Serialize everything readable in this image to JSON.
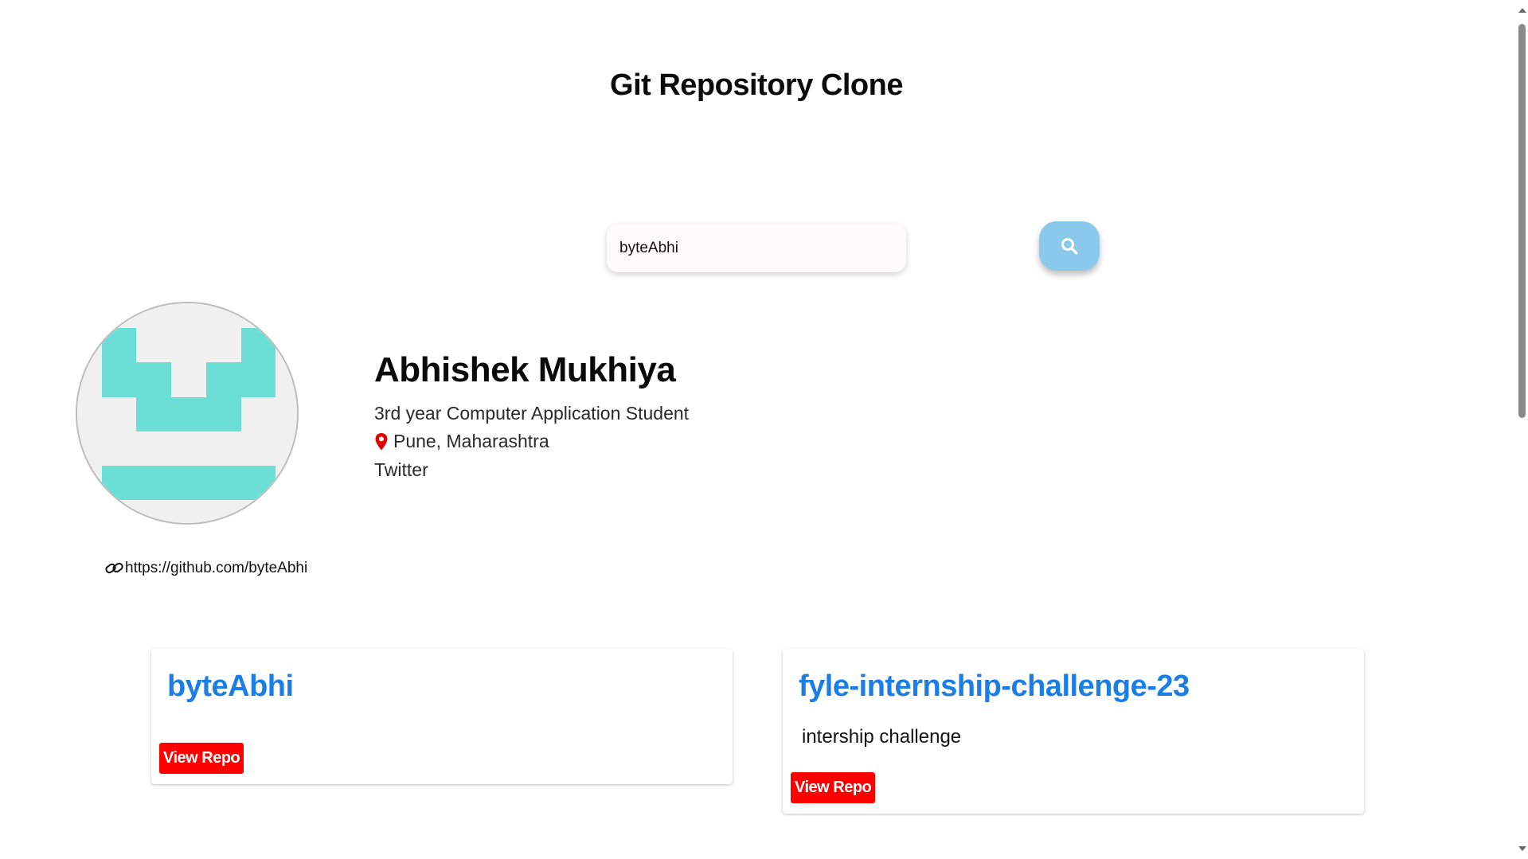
{
  "app": {
    "title": "Git Repository Clone"
  },
  "search": {
    "value": "byteAbhi",
    "button_icon": "search-icon"
  },
  "profile": {
    "name": "Abhishek Mukhiya",
    "bio": "3rd year Computer Application Student",
    "location": "Pune, Maharashtra",
    "location_icon": "map-pin-icon",
    "twitter": "Twitter",
    "github_url": "https://github.com/byteAbhi",
    "link_icon": "link-icon"
  },
  "repos": [
    {
      "name": "byteAbhi",
      "description": "",
      "button_label": "View Repo"
    },
    {
      "name": "fyle-internship-challenge-23",
      "description": "intership challenge",
      "button_label": "View Repo"
    }
  ],
  "colors": {
    "repo_title": "#1a7ee6",
    "view_repo_button": "#ff0000",
    "search_button": "#8ac9ec",
    "avatar_pattern": "#6bded6",
    "location_pin": "#e00000"
  }
}
